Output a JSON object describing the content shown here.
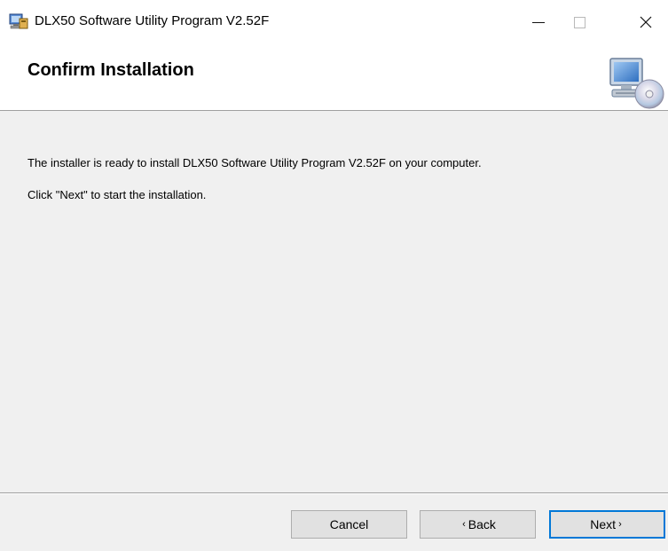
{
  "window": {
    "title": "DLX50 Software Utility Program V2.52F",
    "minimize_icon": "minimize-icon",
    "maximize_icon": "maximize-icon",
    "close_icon": "close-icon",
    "close_glyph": "✕"
  },
  "banner": {
    "title": "Confirm Installation",
    "icon": "computer-cd-icon"
  },
  "body": {
    "line1": "The installer is ready to install DLX50 Software Utility Program V2.52F on your computer.",
    "line2": "Click \"Next\" to start the installation."
  },
  "buttons": {
    "cancel": "Cancel",
    "back": "Back",
    "back_chevron": "‹",
    "next": "Next",
    "next_chevron": "›"
  },
  "colors": {
    "accent": "#0078d7",
    "window_bg": "#f0f0f0",
    "banner_bg": "#ffffff"
  }
}
